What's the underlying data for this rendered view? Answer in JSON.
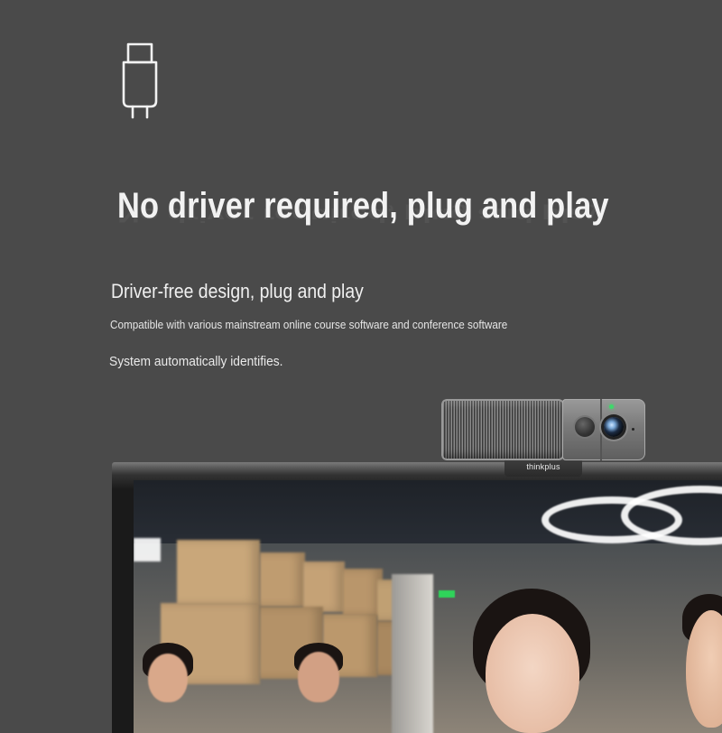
{
  "headline": "No driver required, plug and play",
  "subhead": "Driver-free design, plug and play",
  "compatibility": "Compatible with various mainstream online course software and conference software",
  "auto_identify": "System automatically identifies.",
  "webcam": {
    "brand": "thinkplus",
    "led_color": "#3fd86b"
  },
  "icons": {
    "usb": "usb-plug-icon"
  },
  "colors": {
    "background": "#4a4a4a",
    "text": "#f2f2f2"
  }
}
